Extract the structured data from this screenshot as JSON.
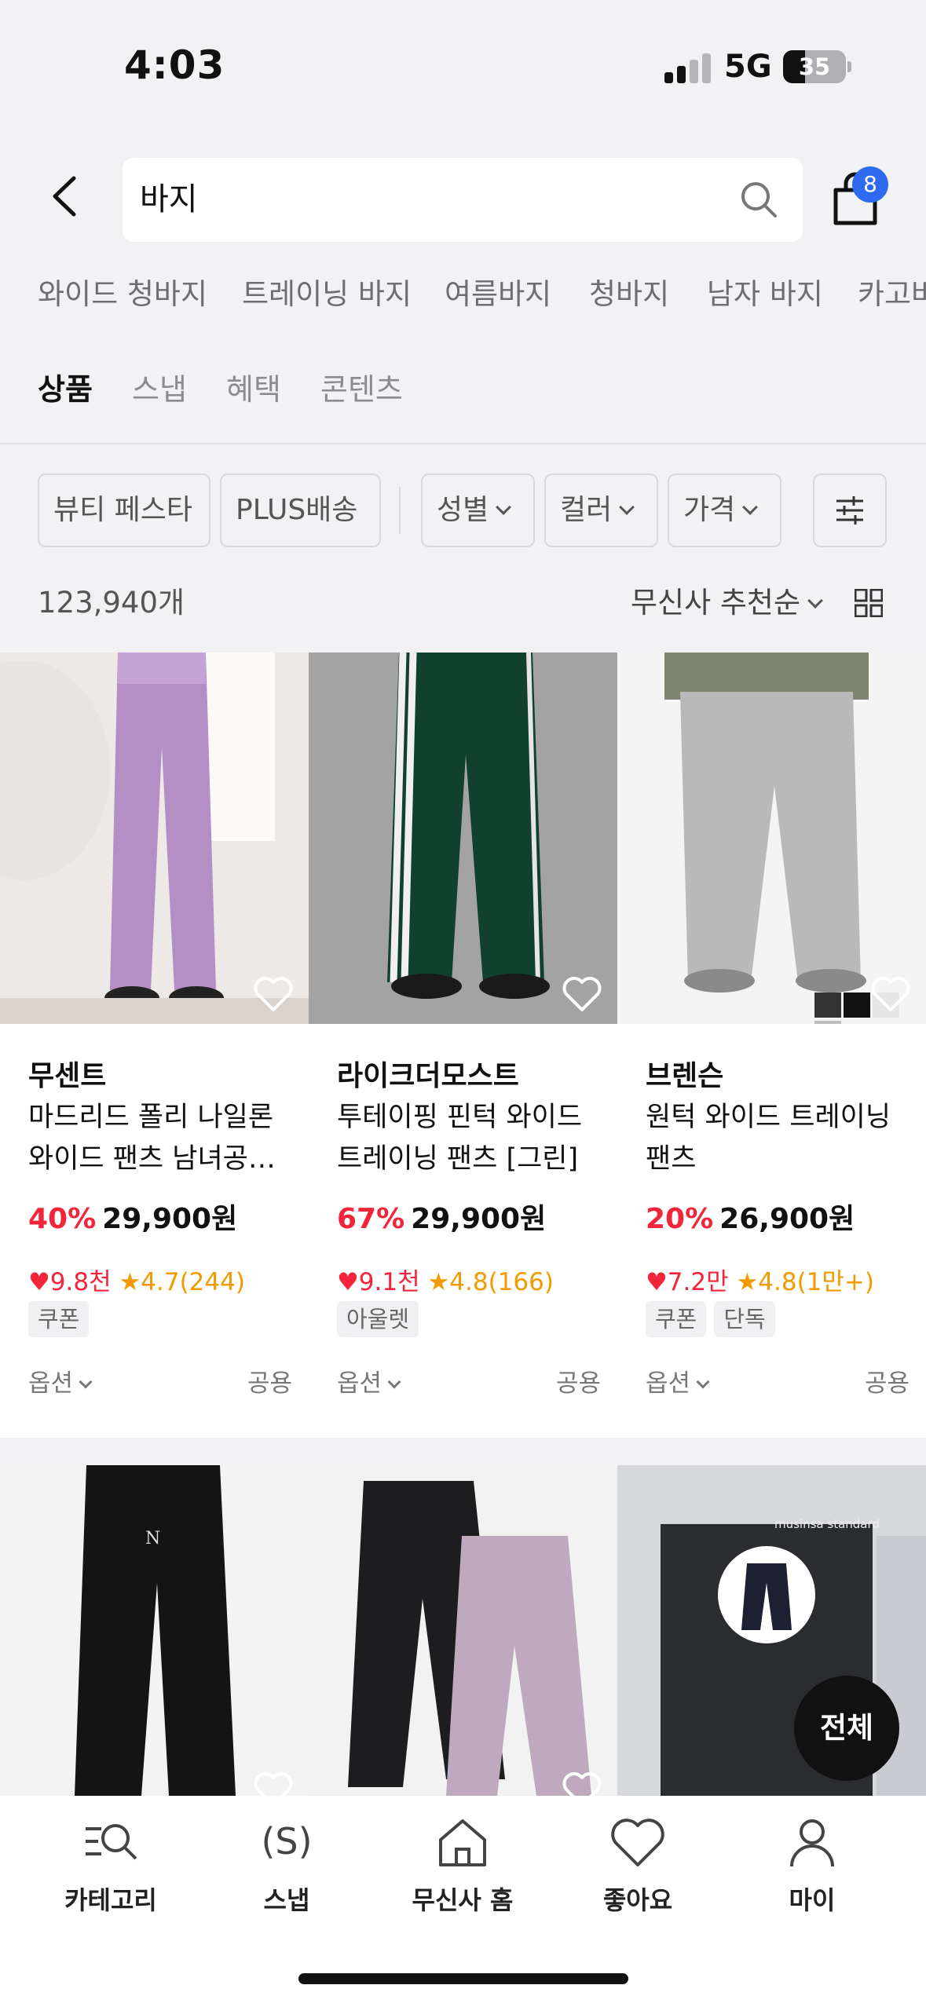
{
  "status_bar": {
    "time": "4:03",
    "network": "5G",
    "battery": "35"
  },
  "search": {
    "query": "바지",
    "cart_count": "8"
  },
  "keywords": [
    "와이드 청바지",
    "트레이닝 바지",
    "여름바지",
    "청바지",
    "남자 바지",
    "카고바"
  ],
  "tabs": [
    "상품",
    "스냅",
    "혜택",
    "콘텐츠"
  ],
  "filters": {
    "chips": [
      "뷰티 페스타",
      "PLUS배송"
    ],
    "dropdowns": [
      "성별",
      "컬러",
      "가격"
    ]
  },
  "results": {
    "count": "123,940개",
    "sort": "무신사 추천순"
  },
  "products": [
    {
      "brand": "무센트",
      "name": "마드리드 폴리 나일론 와이드 팬츠 남녀공…",
      "discount": "40%",
      "price": "29,900원",
      "likes": "9.8천",
      "rating": "4.7(244)",
      "tags": [
        "쿠폰"
      ],
      "option": "옵션",
      "gender": "공용"
    },
    {
      "brand": "라이크더모스트",
      "name": "투테이핑 핀턱 와이드 트레이닝 팬츠 [그린]",
      "discount": "67%",
      "price": "29,900원",
      "likes": "9.1천",
      "rating": "4.8(166)",
      "tags": [
        "아울렛"
      ],
      "option": "옵션",
      "gender": "공용"
    },
    {
      "brand": "브렌슨",
      "name": "원턱 와이드 트레이닝 팬츠",
      "discount": "20%",
      "price": "26,900원",
      "likes": "7.2만",
      "rating": "4.8(1만+)",
      "tags": [
        "쿠폰",
        "단독"
      ],
      "option": "옵션",
      "gender": "공용"
    }
  ],
  "second_row": {
    "store_sign": "musinsa standard",
    "all_label": "전체"
  },
  "bottom_nav": [
    {
      "label": "카테고리",
      "icon": "category-search-icon"
    },
    {
      "label": "스냅",
      "icon": "snap-icon"
    },
    {
      "label": "무신사 홈",
      "icon": "home-icon"
    },
    {
      "label": "좋아요",
      "icon": "heart-icon"
    },
    {
      "label": "마이",
      "icon": "person-icon"
    }
  ],
  "colors": {
    "accent_blue": "#2e6bf0",
    "discount_red": "#f2253a",
    "rating_orange": "#f29a00"
  }
}
